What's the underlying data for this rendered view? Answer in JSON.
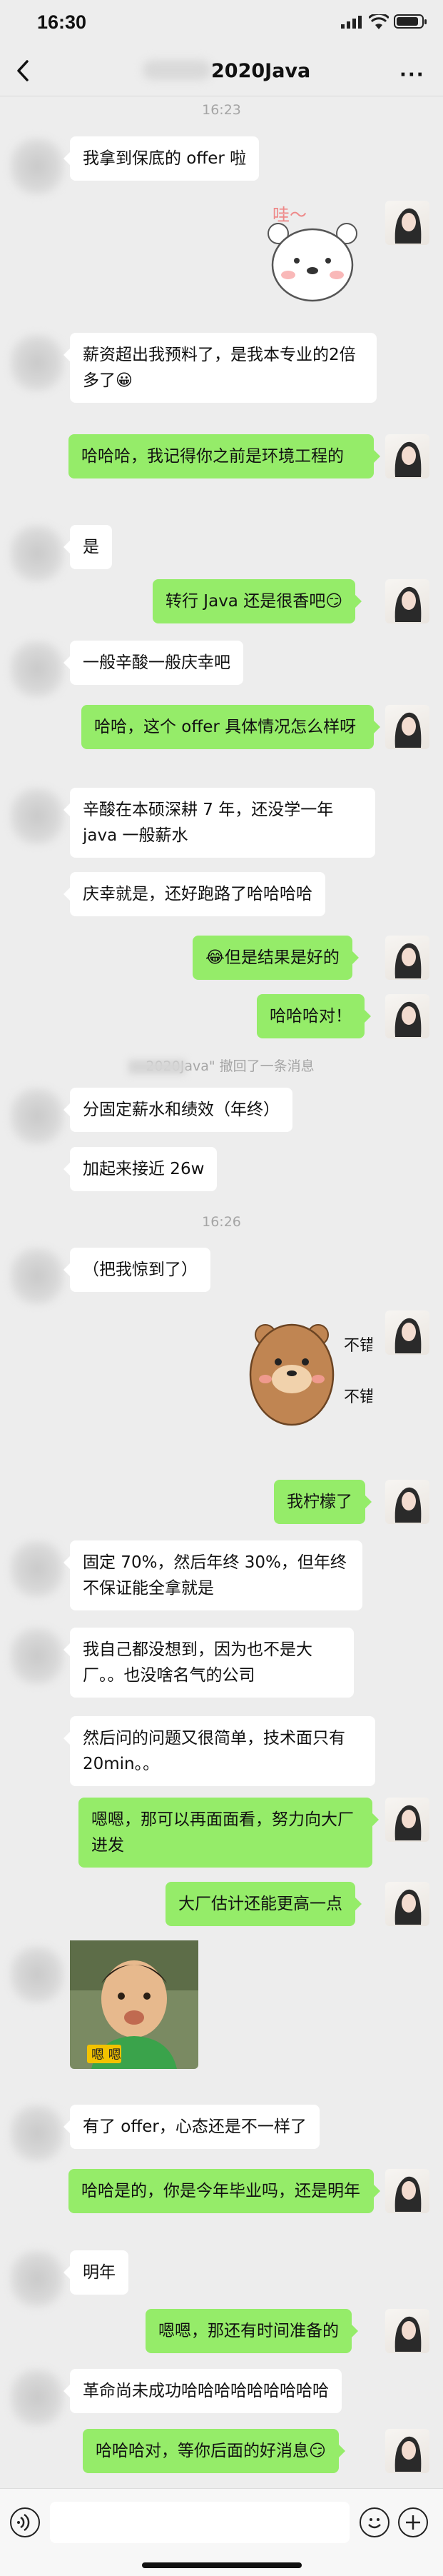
{
  "status_bar": {
    "time": "16:30"
  },
  "header": {
    "title": "2020Java",
    "more": "···"
  },
  "timestamps": [
    "16:23",
    "16:26"
  ],
  "messages": [
    {
      "side": "in",
      "text": "我拿到保底的 offer 啦"
    },
    {
      "side": "out",
      "type": "sticker",
      "caption": "哇～"
    },
    {
      "side": "in",
      "text": "薪资超出我预料了，是我本专业的2倍多了😀"
    },
    {
      "side": "out",
      "text": "哈哈哈，我记得你之前是环境工程的"
    },
    {
      "side": "in",
      "text": "是"
    },
    {
      "side": "out",
      "text": "转行 Java 还是很香吧😏"
    },
    {
      "side": "in",
      "text": "一般辛酸一般庆幸吧"
    },
    {
      "side": "out",
      "text": "哈哈，这个 offer 具体情况怎么样呀"
    },
    {
      "side": "in",
      "text": "辛酸在本硕深耕 7 年，还没学一年 java 一般薪水"
    },
    {
      "side": "in",
      "text": "庆幸就是，还好跑路了哈哈哈哈"
    },
    {
      "side": "out",
      "text": "😂但是结果是好的"
    },
    {
      "side": "out",
      "text": "哈哈哈对！"
    },
    {
      "side": "system",
      "text": "2020Java\" 撤回了一条消息"
    },
    {
      "side": "in",
      "text": "分固定薪水和绩效（年终）"
    },
    {
      "side": "in",
      "text": "加起来接近 26w"
    },
    {
      "side": "in",
      "text": "（把我惊到了）"
    },
    {
      "side": "out",
      "type": "sticker",
      "caption1": "不错",
      "caption2": "不错"
    },
    {
      "side": "out",
      "text": "我柠檬了"
    },
    {
      "side": "in",
      "text": "固定 70%，然后年终 30%，但年终不保证能全拿就是"
    },
    {
      "side": "in",
      "text": "我自己都没想到，因为也不是大厂。。也没啥名气的公司"
    },
    {
      "side": "in",
      "text": "然后问的问题又很简单，技术面只有 20min。。"
    },
    {
      "side": "out",
      "text": "嗯嗯，那可以再面面看，努力向大厂进发"
    },
    {
      "side": "out",
      "text": "大厂估计还能更高一点"
    },
    {
      "side": "in",
      "type": "sticker",
      "caption": "嗯 嗯"
    },
    {
      "side": "in",
      "text": "有了 offer，心态还是不一样了"
    },
    {
      "side": "out",
      "text": "哈哈是的，你是今年毕业吗，还是明年"
    },
    {
      "side": "in",
      "text": "明年"
    },
    {
      "side": "out",
      "text": "嗯嗯，那还有时间准备的"
    },
    {
      "side": "in",
      "text": "革命尚未成功哈哈哈哈哈哈哈哈哈"
    },
    {
      "side": "out",
      "text": "哈哈哈对，等你后面的好消息😏"
    }
  ],
  "icons": {
    "back": "chevron-left-icon",
    "more": "more-dots-icon",
    "voice": "voice-icon",
    "emoji": "emoji-icon",
    "plus": "plus-icon"
  },
  "colors": {
    "background": "#ededed",
    "incoming": "#ffffff",
    "outgoing": "#95ec69"
  }
}
